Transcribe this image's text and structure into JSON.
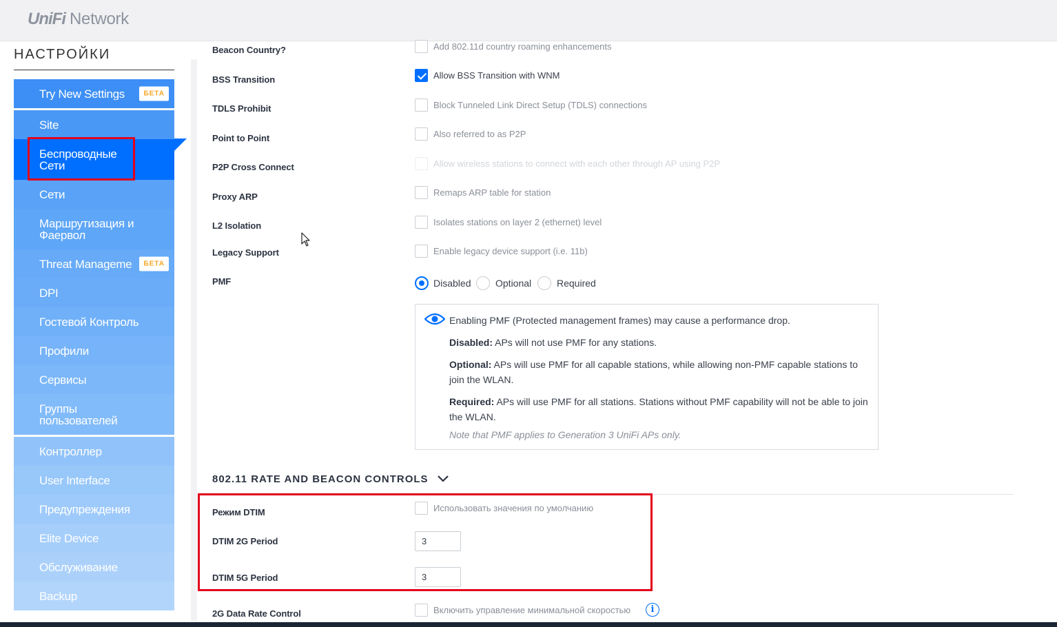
{
  "header": {
    "logo_brand": "UniFi",
    "logo_product": "Network"
  },
  "sidebar": {
    "title": "НАСТРОЙКИ",
    "items": [
      {
        "label": "Try New Settings",
        "badge": "БЕТА",
        "color": "#3d8ff5"
      },
      {
        "label": "Site",
        "color": "#4a98f5"
      },
      {
        "label": "Беспроводные Сети",
        "color": "#006fff",
        "active": true
      },
      {
        "label": "Сети",
        "color": "#59a2f7"
      },
      {
        "label": "Маршрутизация и Фаервол",
        "color": "#5ea6f7"
      },
      {
        "label": "Threat Manageme",
        "badge": "БЕТА",
        "color": "#66aaf8"
      },
      {
        "label": "DPI",
        "color": "#6aacf8"
      },
      {
        "label": "Гостевой Контроль",
        "color": "#70b0f8"
      },
      {
        "label": "Профили",
        "color": "#76b3f9"
      },
      {
        "label": "Сервисы",
        "color": "#7cb7f9"
      },
      {
        "label": "Группы пользователей",
        "color": "#82bbf9"
      },
      {
        "label": "Контроллер",
        "color": "#91c3fa"
      },
      {
        "label": "User Interface",
        "color": "#98c7fa"
      },
      {
        "label": "Предупреждения",
        "color": "#9ecafb"
      },
      {
        "label": "Elite Device",
        "color": "#a5cefb"
      },
      {
        "label": "Обслуживание",
        "color": "#abd1fb"
      },
      {
        "label": "Backup",
        "color": "#b2d5fc"
      }
    ]
  },
  "main": {
    "rows": [
      {
        "label": "Beacon Country?",
        "text": "Add 802.11d country roaming enhancements",
        "checked": false
      },
      {
        "label": "BSS Transition",
        "text": "Allow BSS Transition with WNM",
        "checked": true
      },
      {
        "label": "TDLS Prohibit",
        "text": "Block Tunneled Link Direct Setup (TDLS) connections",
        "checked": false
      },
      {
        "label": "Point to Point",
        "text": "Also referred to as P2P",
        "checked": false
      },
      {
        "label": "P2P Cross Connect",
        "text": "Allow wireless stations to connect with each other through AP using P2P",
        "checked": false,
        "disabled": true
      },
      {
        "label": "Proxy ARP",
        "text": "Remaps ARP table for station",
        "checked": false
      },
      {
        "label": "L2 Isolation",
        "text": "Isolates stations on layer 2 (ethernet) level",
        "checked": false
      },
      {
        "label": "Legacy Support",
        "text": "Enable legacy device support (i.e. 11b)",
        "checked": false
      }
    ],
    "pmf": {
      "label": "PMF",
      "options": [
        "Disabled",
        "Optional",
        "Required"
      ],
      "selected": "Disabled",
      "info": {
        "headline": "Enabling PMF (Protected management frames) may cause a performance drop.",
        "disabled_term": "Disabled:",
        "disabled_text": " APs will not use PMF for any stations.",
        "optional_term": "Optional:",
        "optional_text": " APs will use PMF for all capable stations, while allowing non-PMF capable stations to join the WLAN.",
        "required_term": "Required:",
        "required_text": " APs will use PMF for all stations. Stations without PMF capability will not be able to join the WLAN.",
        "note": "Note that PMF applies to Generation 3 UniFi APs only."
      }
    },
    "section": {
      "title": "802.11 RATE AND BEACON CONTROLS"
    },
    "dtim": {
      "mode_label_bold": "Режим",
      "mode_label_rest": " DTIM",
      "mode_text": "Использовать значения по умолчанию",
      "p2g_label": "DTIM 2G Period",
      "p2g_value": "3",
      "p5g_label": "DTIM 5G Period",
      "p5g_value": "3"
    },
    "data_rate": {
      "label": "2G Data Rate Control",
      "text": "Включить управление минимальной скоростью",
      "info_glyph": "i"
    }
  },
  "colors": {
    "accent": "#006fff",
    "highlight": "#e3001b"
  }
}
